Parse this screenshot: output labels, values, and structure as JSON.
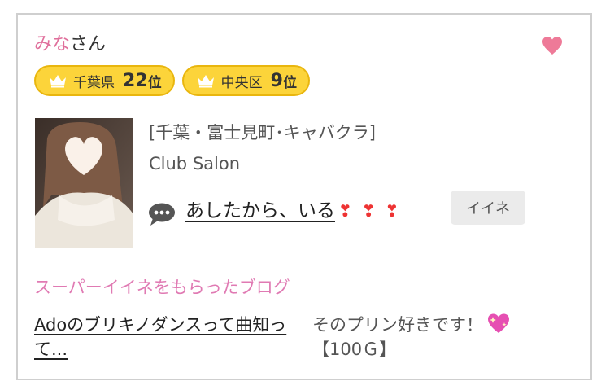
{
  "user": {
    "name": "みな",
    "suffix": "さん"
  },
  "badges": [
    {
      "area": "千葉県",
      "rank_num": "22",
      "rank_suffix": "位"
    },
    {
      "area": "中央区",
      "rank_num": "9",
      "rank_suffix": "位"
    }
  ],
  "profile": {
    "shop": "[千葉・富士見町･キャバクラ]",
    "club": "Club Salon",
    "comment": "あしたから、いる",
    "comment_hearts": [
      "❣",
      "❣",
      "❣"
    ],
    "like_button": "イイネ"
  },
  "blog_section": {
    "title": "スーパーイイネをもらったブログ",
    "post_title": "Adoのブリキノダンスって曲知って...",
    "excerpt": "そのプリン好きです！",
    "price": "【100Ｇ】"
  },
  "colors": {
    "accent_pink": "#e0709c",
    "heart": "#ee7a98",
    "badge_fill": "#fcd43a",
    "badge_border": "#e9b60e",
    "section_pink": "#e07ab3"
  },
  "icons": {
    "favorite": "heart-icon",
    "rank": "crown-icon",
    "comment": "speech-bubble-icon",
    "emoji": "sparkling-heart-icon"
  }
}
